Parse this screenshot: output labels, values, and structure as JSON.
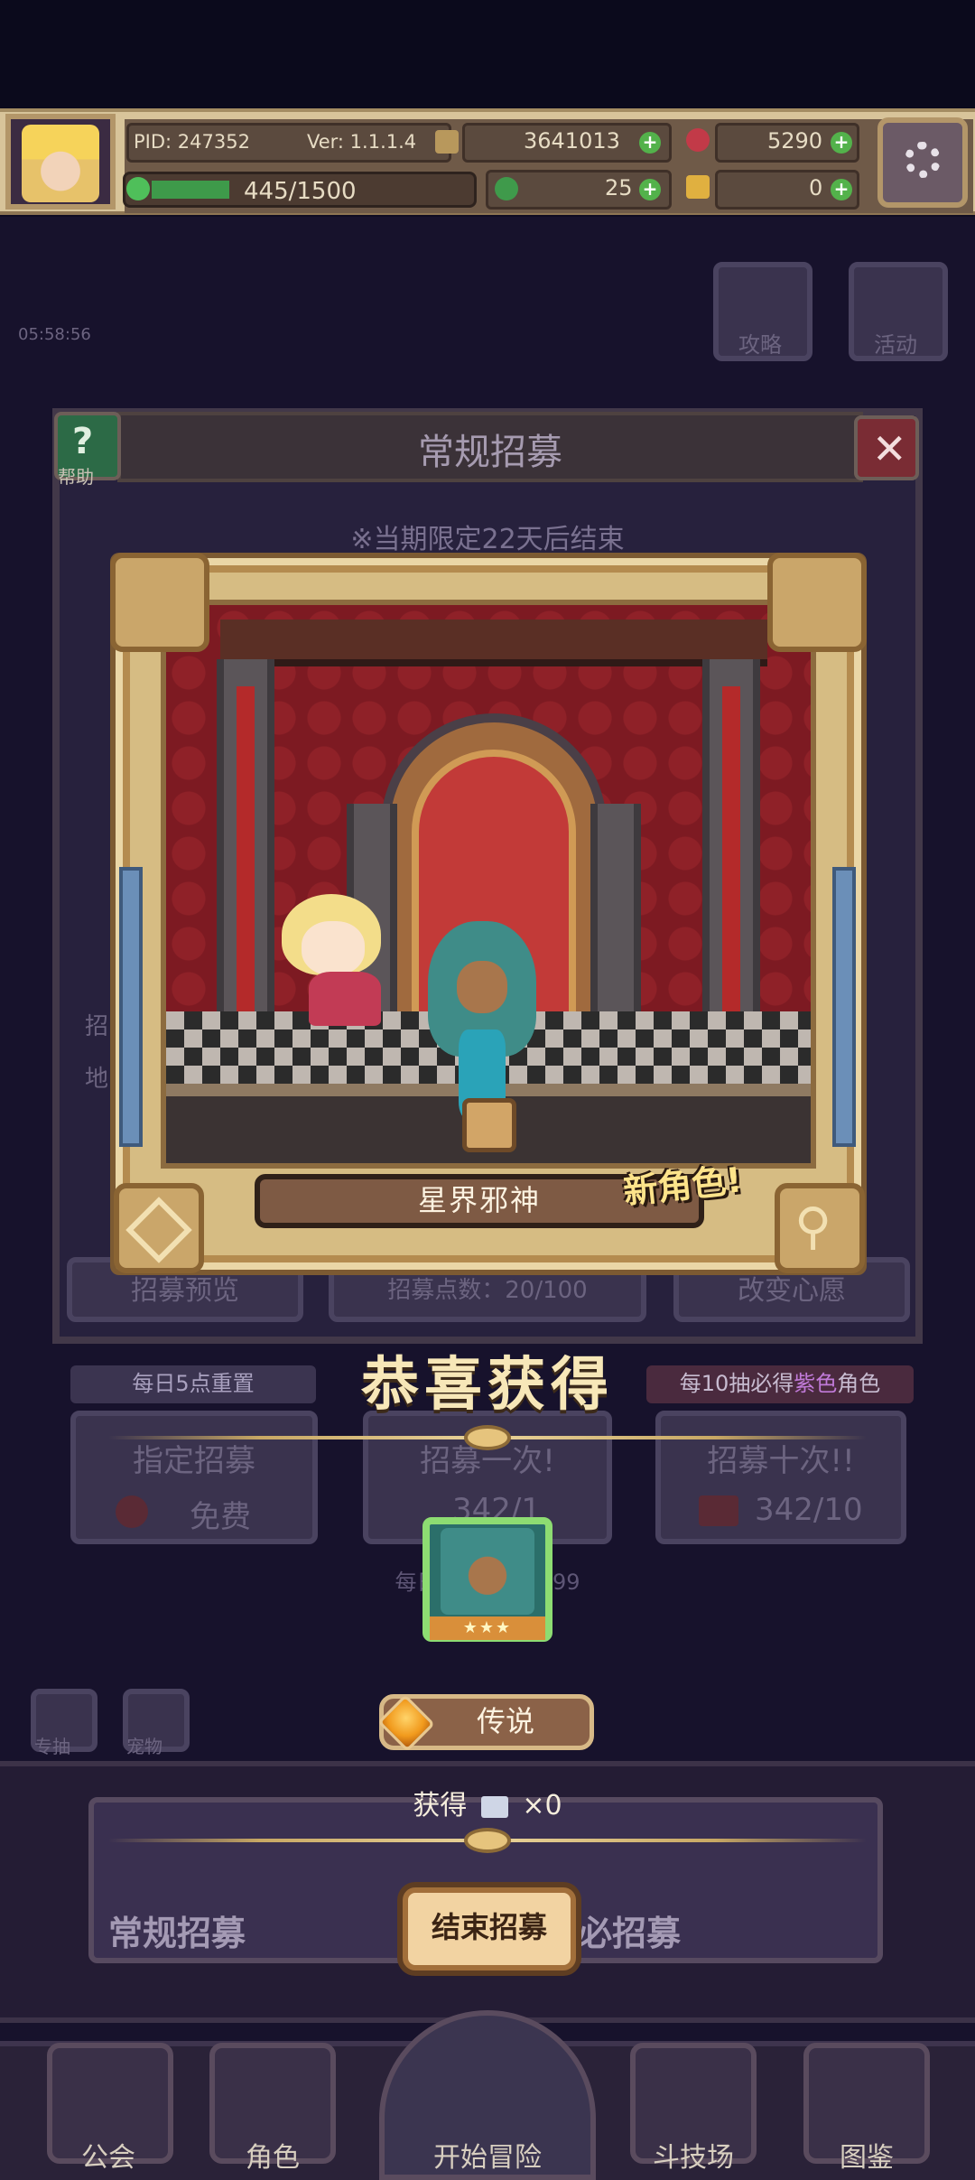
{
  "hud": {
    "pid": "PID: 247352",
    "version": "Ver: 1.1.1.4",
    "gold": "3641013",
    "gems": "5290",
    "stamina": "445/1500",
    "clover": "25",
    "keys": "0"
  },
  "background": {
    "timer": "05:58:56",
    "guide_label": "攻略",
    "event_label": "活动",
    "panel_title": "常规招募",
    "help_label": "帮助",
    "limited_notice": "※当期限定22天后结束",
    "side_label_1": "招",
    "side_label_2": "地",
    "preview_label": "招募预览",
    "points_label": "招募点数：20/100",
    "change_wish": "改变心愿",
    "daily_reset": "每日5点重置",
    "guarantee_prefix": "每10抽必得",
    "guarantee_highlight": "紫色",
    "guarantee_suffix": "角色",
    "designated": "指定招募",
    "free": "免费",
    "once": "招募一次!",
    "once_cost": "342/1",
    "ten": "招募十次!!",
    "ten_cost": "342/10",
    "daily_limit": "每日招募上限9999",
    "banner_left": "常规招募",
    "banner_right": "必招募",
    "icon_left": "专抽",
    "icon_right": "宠物"
  },
  "result": {
    "character_name": "星界邪神",
    "new_badge": "新角色!",
    "congrats": "恭喜获得",
    "stars": "★★★",
    "rarity": "传说",
    "obtain_prefix": "获得",
    "obtain_count": "×0",
    "end_button": "结束招募"
  },
  "nav": {
    "guild": "公会",
    "character": "角色",
    "adventure": "开始冒险",
    "arena": "斗技场",
    "codex": "图鉴"
  },
  "colors": {
    "accent_gold": "#e6c47d",
    "legend_orange": "#f19a1d",
    "highlight_purple": "#c07ad8"
  }
}
